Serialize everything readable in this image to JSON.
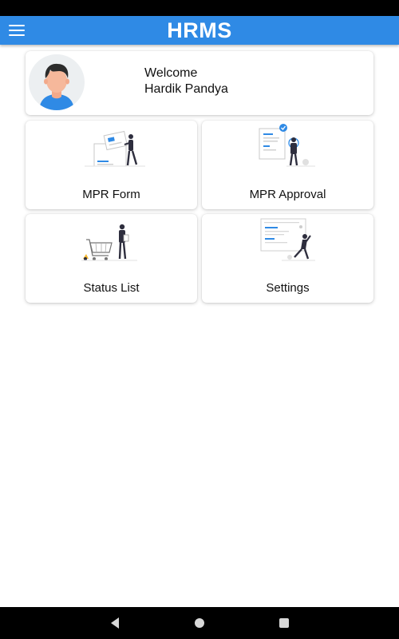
{
  "app_bar": {
    "title": "HRMS",
    "color": "#2f8ae5",
    "menu_icon": "hamburger-menu-icon"
  },
  "welcome": {
    "greeting": "Welcome",
    "user_name": "Hardik Pandya",
    "avatar_icon": "user-avatar-icon"
  },
  "tiles": [
    {
      "label": "MPR Form",
      "icon": "form-illustration-icon"
    },
    {
      "label": "MPR Approval",
      "icon": "approval-illustration-icon"
    },
    {
      "label": "Status List",
      "icon": "shopping-cart-illustration-icon"
    },
    {
      "label": "Settings",
      "icon": "settings-illustration-icon"
    }
  ],
  "nav_bar": {
    "back_icon": "back-triangle-icon",
    "home_icon": "home-circle-icon",
    "recents_icon": "recents-square-icon"
  }
}
